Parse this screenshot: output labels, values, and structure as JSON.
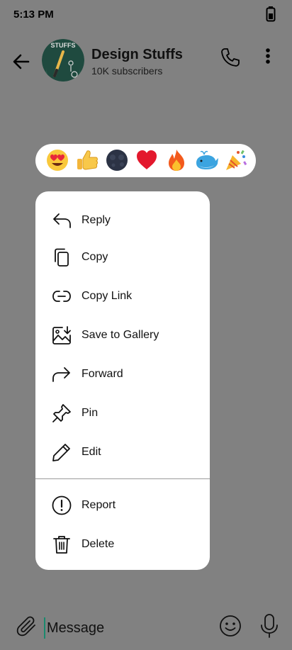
{
  "status_bar": {
    "time": "5:13 PM"
  },
  "header": {
    "channel_name": "Design Stuffs",
    "subscribers": "10K subscribers",
    "avatar_text": "STUFFS"
  },
  "reactions": [
    "heart-eyes",
    "thumbs-up",
    "new-moon-face",
    "red-heart",
    "fire",
    "whale",
    "party-popper"
  ],
  "menu": {
    "items": [
      {
        "label": "Reply",
        "icon": "reply-icon"
      },
      {
        "label": "Copy",
        "icon": "copy-icon"
      },
      {
        "label": "Copy Link",
        "icon": "link-icon"
      },
      {
        "label": "Save to Gallery",
        "icon": "save-gallery-icon"
      },
      {
        "label": "Forward",
        "icon": "forward-icon"
      },
      {
        "label": "Pin",
        "icon": "pin-icon"
      },
      {
        "label": "Edit",
        "icon": "pencil-icon"
      },
      {
        "label": "Report",
        "icon": "report-icon"
      },
      {
        "label": "Delete",
        "icon": "trash-icon"
      }
    ]
  },
  "composer": {
    "placeholder": "Message"
  },
  "colors": {
    "overlay": "#818181",
    "menu_bg": "#ffffff",
    "cursor": "#1a8a6e"
  }
}
